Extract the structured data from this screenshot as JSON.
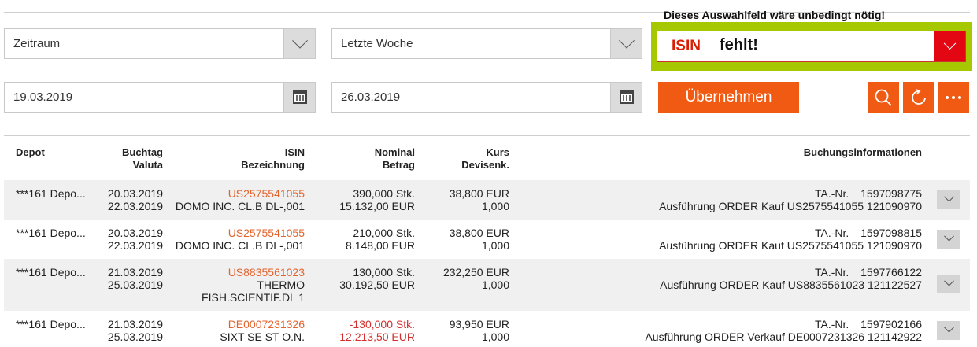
{
  "filters": {
    "period_label": "Zeitraum",
    "period_value": "Letzte Woche",
    "date_from": "19.03.2019",
    "date_to": "26.03.2019",
    "apply_label": "Übernehmen"
  },
  "annotation": {
    "hint": "Dieses Auswahlfeld wäre unbedingt nötig!",
    "isin_label": "ISIN",
    "isin_message": "fehlt!"
  },
  "icons": {
    "search": "search-icon",
    "refresh": "refresh-icon",
    "more": "more-icon"
  },
  "table": {
    "headers": {
      "depot": "Depot",
      "buchtag": "Buchtag",
      "valuta": "Valuta",
      "isin": "ISIN",
      "bezeichnung": "Bezeichnung",
      "nominal": "Nominal",
      "betrag": "Betrag",
      "kurs": "Kurs",
      "devisenk": "Devisenk.",
      "buchungsinfo": "Buchungsinformationen"
    },
    "rows": [
      {
        "depot": "***161 Depo...",
        "buchtag": "20.03.2019",
        "valuta": "22.03.2019",
        "isin": "US2575541055",
        "bez1": "DOMO INC. CL.B DL-,001",
        "bez2": "",
        "nominal": "390,000 Stk.",
        "betrag": "15.132,00 EUR",
        "kurs": "38,800 EUR",
        "devisenk": "1,000",
        "ta_label": "TA.-Nr.",
        "ta_nr": "1597098775",
        "info": "Ausführung ORDER Kauf US2575541055 121090970"
      },
      {
        "depot": "***161 Depo...",
        "buchtag": "20.03.2019",
        "valuta": "22.03.2019",
        "isin": "US2575541055",
        "bez1": "DOMO INC. CL.B DL-,001",
        "bez2": "",
        "nominal": "210,000 Stk.",
        "betrag": "8.148,00 EUR",
        "kurs": "38,800 EUR",
        "devisenk": "1,000",
        "ta_label": "TA.-Nr.",
        "ta_nr": "1597098815",
        "info": "Ausführung ORDER Kauf US2575541055 121090970"
      },
      {
        "depot": "***161 Depo...",
        "buchtag": "21.03.2019",
        "valuta": "25.03.2019",
        "isin": "US8835561023",
        "bez1": "THERMO",
        "bez2": "FISH.SCIENTIF.DL 1",
        "nominal": "130,000 Stk.",
        "betrag": "30.192,50 EUR",
        "kurs": "232,250 EUR",
        "devisenk": "1,000",
        "ta_label": "TA.-Nr.",
        "ta_nr": "1597766122",
        "info": "Ausführung ORDER Kauf US8835561023 121122527"
      },
      {
        "depot": "***161 Depo...",
        "buchtag": "21.03.2019",
        "valuta": "25.03.2019",
        "isin": "DE0007231326",
        "bez1": "SIXT SE ST O.N.",
        "bez2": "",
        "nominal": "-130,000 Stk.",
        "betrag": "-12.213,50 EUR",
        "kurs": "93,950 EUR",
        "devisenk": "1,000",
        "ta_label": "TA.-Nr.",
        "ta_nr": "1597902166",
        "info": "Ausführung ORDER Verkauf DE0007231326 121142922"
      }
    ]
  },
  "colors": {
    "accent": "#f15a12",
    "highlight": "#a6c800",
    "error": "#d81e05",
    "link": "#e3632c"
  }
}
